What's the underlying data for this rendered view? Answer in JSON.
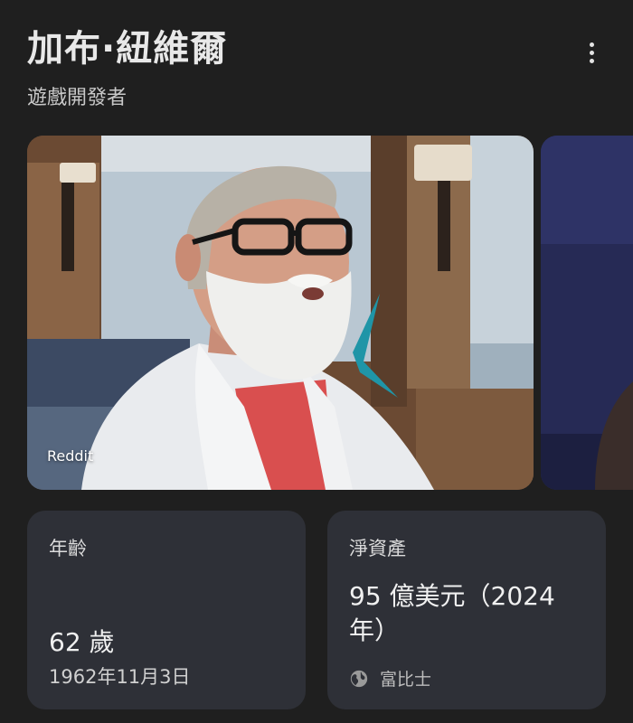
{
  "header": {
    "title": "加布·紐維爾",
    "subtitle": "遊戲開發者",
    "more_icon": "more-vert-icon"
  },
  "carousel": {
    "images": [
      {
        "source": "Reddit",
        "description_icon": "photo"
      },
      {
        "source": ""
      }
    ]
  },
  "cards": {
    "age": {
      "label": "年齡",
      "value": "62 歲",
      "detail": "1962年11月3日"
    },
    "net_worth": {
      "label": "淨資產",
      "value": "95 億美元（2024 年）",
      "source": "富比士",
      "source_icon": "globe-icon"
    }
  },
  "colors": {
    "background": "#1f1f1f",
    "card": "#2e3037",
    "text": "#e3e3e3"
  }
}
